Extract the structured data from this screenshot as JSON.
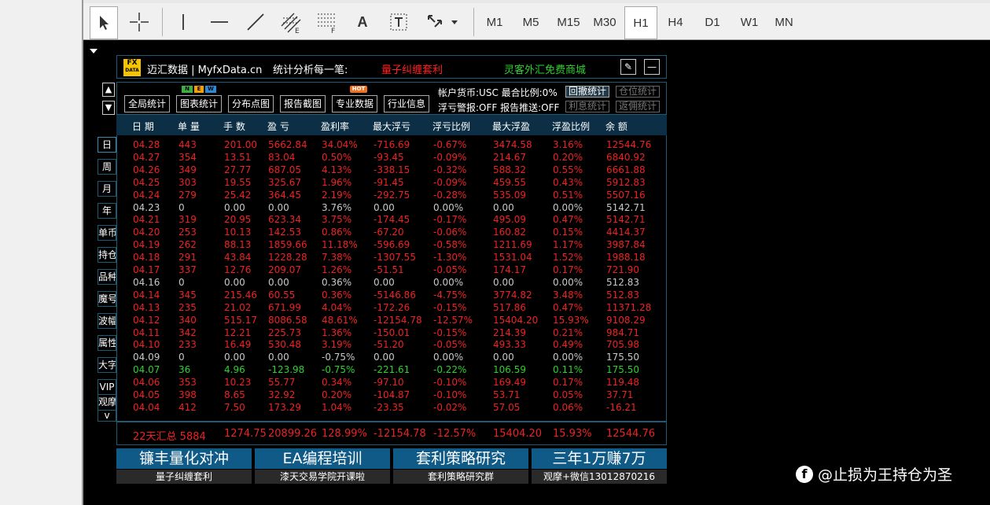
{
  "toolbar": {
    "timeframes": [
      "M1",
      "M5",
      "M15",
      "M30",
      "H1",
      "H4",
      "D1",
      "W1",
      "MN"
    ],
    "selected_timeframe": "H1",
    "text_tool": "A"
  },
  "panel": {
    "logo_top": "FX",
    "logo_bottom": "DATA",
    "brand": "迈汇数据 | MyfxData.cn",
    "slogan": "统计分析每一笔:",
    "link_red": "量子纠缠套利",
    "link_green": "灵客外汇免费商城",
    "edit_icon": "✎",
    "minimize_icon": "—"
  },
  "nav_up": "▲",
  "nav_down": "▼",
  "side_buttons": [
    "日",
    "周",
    "月",
    "年",
    "单币",
    "持仓",
    "品种",
    "魔号",
    "波幅",
    "属性",
    "大字",
    "VIP",
    "观摩"
  ],
  "side_more": "v",
  "func_buttons": [
    {
      "label": "全局统计"
    },
    {
      "label": "图表统计",
      "badges": [
        "N",
        "E",
        "W"
      ]
    },
    {
      "label": "分布点图"
    },
    {
      "label": "报告截图"
    },
    {
      "label": "专业数据",
      "badges": [
        "HOT"
      ]
    },
    {
      "label": "行业信息"
    }
  ],
  "info": {
    "line1": "帐户货币:USC  最合比例:0%",
    "line2": "浮亏警报:OFF  报告推送:OFF"
  },
  "stat_buttons": {
    "huiche": "回撤统计",
    "cangwei": "仓位统计",
    "lixi": "利息统计",
    "fanyong": "返佣统计"
  },
  "columns": [
    "日 期",
    "单 量",
    "手 数",
    "盈 亏",
    "盈利率",
    "最大浮亏",
    "浮亏比例",
    "最大浮盈",
    "浮盈比例",
    "余 额"
  ],
  "rows": [
    {
      "c": "red",
      "v": [
        "04.28",
        "443",
        "201.00",
        "5662.84",
        "34.04%",
        "-716.69",
        "-0.67%",
        "3474.58",
        "3.16%",
        "12544.76"
      ]
    },
    {
      "c": "red",
      "v": [
        "04.27",
        "354",
        "13.51",
        "83.04",
        "0.50%",
        "-93.45",
        "-0.09%",
        "214.67",
        "0.20%",
        "6840.92"
      ]
    },
    {
      "c": "red",
      "v": [
        "04.26",
        "349",
        "27.77",
        "687.05",
        "4.13%",
        "-338.15",
        "-0.32%",
        "588.32",
        "0.55%",
        "6661.88"
      ]
    },
    {
      "c": "red",
      "v": [
        "04.25",
        "303",
        "19.55",
        "325.67",
        "1.96%",
        "-91.45",
        "-0.09%",
        "459.55",
        "0.43%",
        "5912.83"
      ]
    },
    {
      "c": "red",
      "v": [
        "04.24",
        "279",
        "25.42",
        "364.45",
        "2.19%",
        "-292.75",
        "-0.28%",
        "535.09",
        "0.51%",
        "5507.16"
      ]
    },
    {
      "c": "gray",
      "v": [
        "04.23",
        "0",
        "0.00",
        "0.00",
        "3.76%",
        "0.00",
        "0.00%",
        "0.00",
        "0.00%",
        "5142.71"
      ]
    },
    {
      "c": "red",
      "v": [
        "04.21",
        "319",
        "20.95",
        "623.34",
        "3.75%",
        "-174.45",
        "-0.17%",
        "495.09",
        "0.47%",
        "5142.71"
      ]
    },
    {
      "c": "red",
      "v": [
        "04.20",
        "253",
        "10.13",
        "142.53",
        "0.86%",
        "-67.20",
        "-0.06%",
        "160.82",
        "0.15%",
        "4414.37"
      ]
    },
    {
      "c": "red",
      "v": [
        "04.19",
        "262",
        "88.13",
        "1859.66",
        "11.18%",
        "-596.69",
        "-0.58%",
        "1211.69",
        "1.17%",
        "3987.84"
      ]
    },
    {
      "c": "red",
      "v": [
        "04.18",
        "291",
        "43.84",
        "1228.28",
        "7.38%",
        "-1307.55",
        "-1.30%",
        "1531.04",
        "1.52%",
        "1988.18"
      ]
    },
    {
      "c": "red",
      "v": [
        "04.17",
        "337",
        "12.76",
        "209.07",
        "1.26%",
        "-51.51",
        "-0.05%",
        "174.17",
        "0.17%",
        "721.90"
      ]
    },
    {
      "c": "gray",
      "v": [
        "04.16",
        "0",
        "0.00",
        "0.00",
        "0.36%",
        "0.00",
        "0.00%",
        "0.00",
        "0.00%",
        "512.83"
      ]
    },
    {
      "c": "red",
      "v": [
        "04.14",
        "345",
        "215.46",
        "60.55",
        "0.36%",
        "-5146.86",
        "-4.75%",
        "3774.82",
        "3.48%",
        "512.83"
      ]
    },
    {
      "c": "red",
      "v": [
        "04.13",
        "235",
        "21.02",
        "671.99",
        "4.04%",
        "-172.26",
        "-0.15%",
        "517.86",
        "0.47%",
        "11371.28"
      ]
    },
    {
      "c": "red",
      "v": [
        "04.12",
        "340",
        "515.17",
        "8086.58",
        "48.61%",
        "-12154.78",
        "-12.57%",
        "15404.20",
        "15.93%",
        "9108.29"
      ]
    },
    {
      "c": "red",
      "v": [
        "04.11",
        "342",
        "12.21",
        "225.73",
        "1.36%",
        "-150.01",
        "-0.15%",
        "214.39",
        "0.21%",
        "984.71"
      ]
    },
    {
      "c": "red",
      "v": [
        "04.10",
        "233",
        "16.49",
        "530.48",
        "3.19%",
        "-51.20",
        "-0.05%",
        "493.33",
        "0.49%",
        "705.98"
      ]
    },
    {
      "c": "gray",
      "v": [
        "04.09",
        "0",
        "0.00",
        "0.00",
        "-0.75%",
        "0.00",
        "0.00%",
        "0.00",
        "0.00%",
        "175.50"
      ]
    },
    {
      "c": "green",
      "v": [
        "04.07",
        "36",
        "4.96",
        "-123.98",
        "-0.75%",
        "-221.61",
        "-0.22%",
        "106.59",
        "0.11%",
        "175.50"
      ]
    },
    {
      "c": "red",
      "v": [
        "04.06",
        "353",
        "10.23",
        "55.77",
        "0.34%",
        "-97.10",
        "-0.10%",
        "169.49",
        "0.17%",
        "119.48"
      ]
    },
    {
      "c": "red",
      "v": [
        "04.05",
        "398",
        "8.65",
        "32.92",
        "0.20%",
        "-104.87",
        "-0.10%",
        "53.71",
        "0.05%",
        "37.71"
      ]
    },
    {
      "c": "red",
      "v": [
        "04.04",
        "412",
        "7.50",
        "173.29",
        "1.04%",
        "-23.35",
        "-0.02%",
        "57.05",
        "0.06%",
        "-16.21"
      ]
    }
  ],
  "total": [
    "22天汇总 5884",
    "1274.75",
    "20899.26",
    "128.99%",
    "-12154.78",
    "-12.57%",
    "15404.20",
    "15.93%",
    "12544.76"
  ],
  "ads": [
    {
      "big": "镰丰量化对冲",
      "small": "量子纠缠套利"
    },
    {
      "big": "EA编程培训",
      "small": "漆天交易学院开课啦"
    },
    {
      "big": "套利策略研究",
      "small": "套利策略研究群"
    },
    {
      "big": "三年1万赚7万",
      "small": "观摩+微信13012870216"
    }
  ],
  "watermark": {
    "icon": "f",
    "text": "@止损为王持仓为圣"
  },
  "colors": {
    "header_bg": "#0c2f45",
    "border": "#1d5a73",
    "profit": "#ee2222",
    "loss": "#2fd12f",
    "neutral": "#c8c8c8",
    "ad_bg": "#0f5a86"
  }
}
